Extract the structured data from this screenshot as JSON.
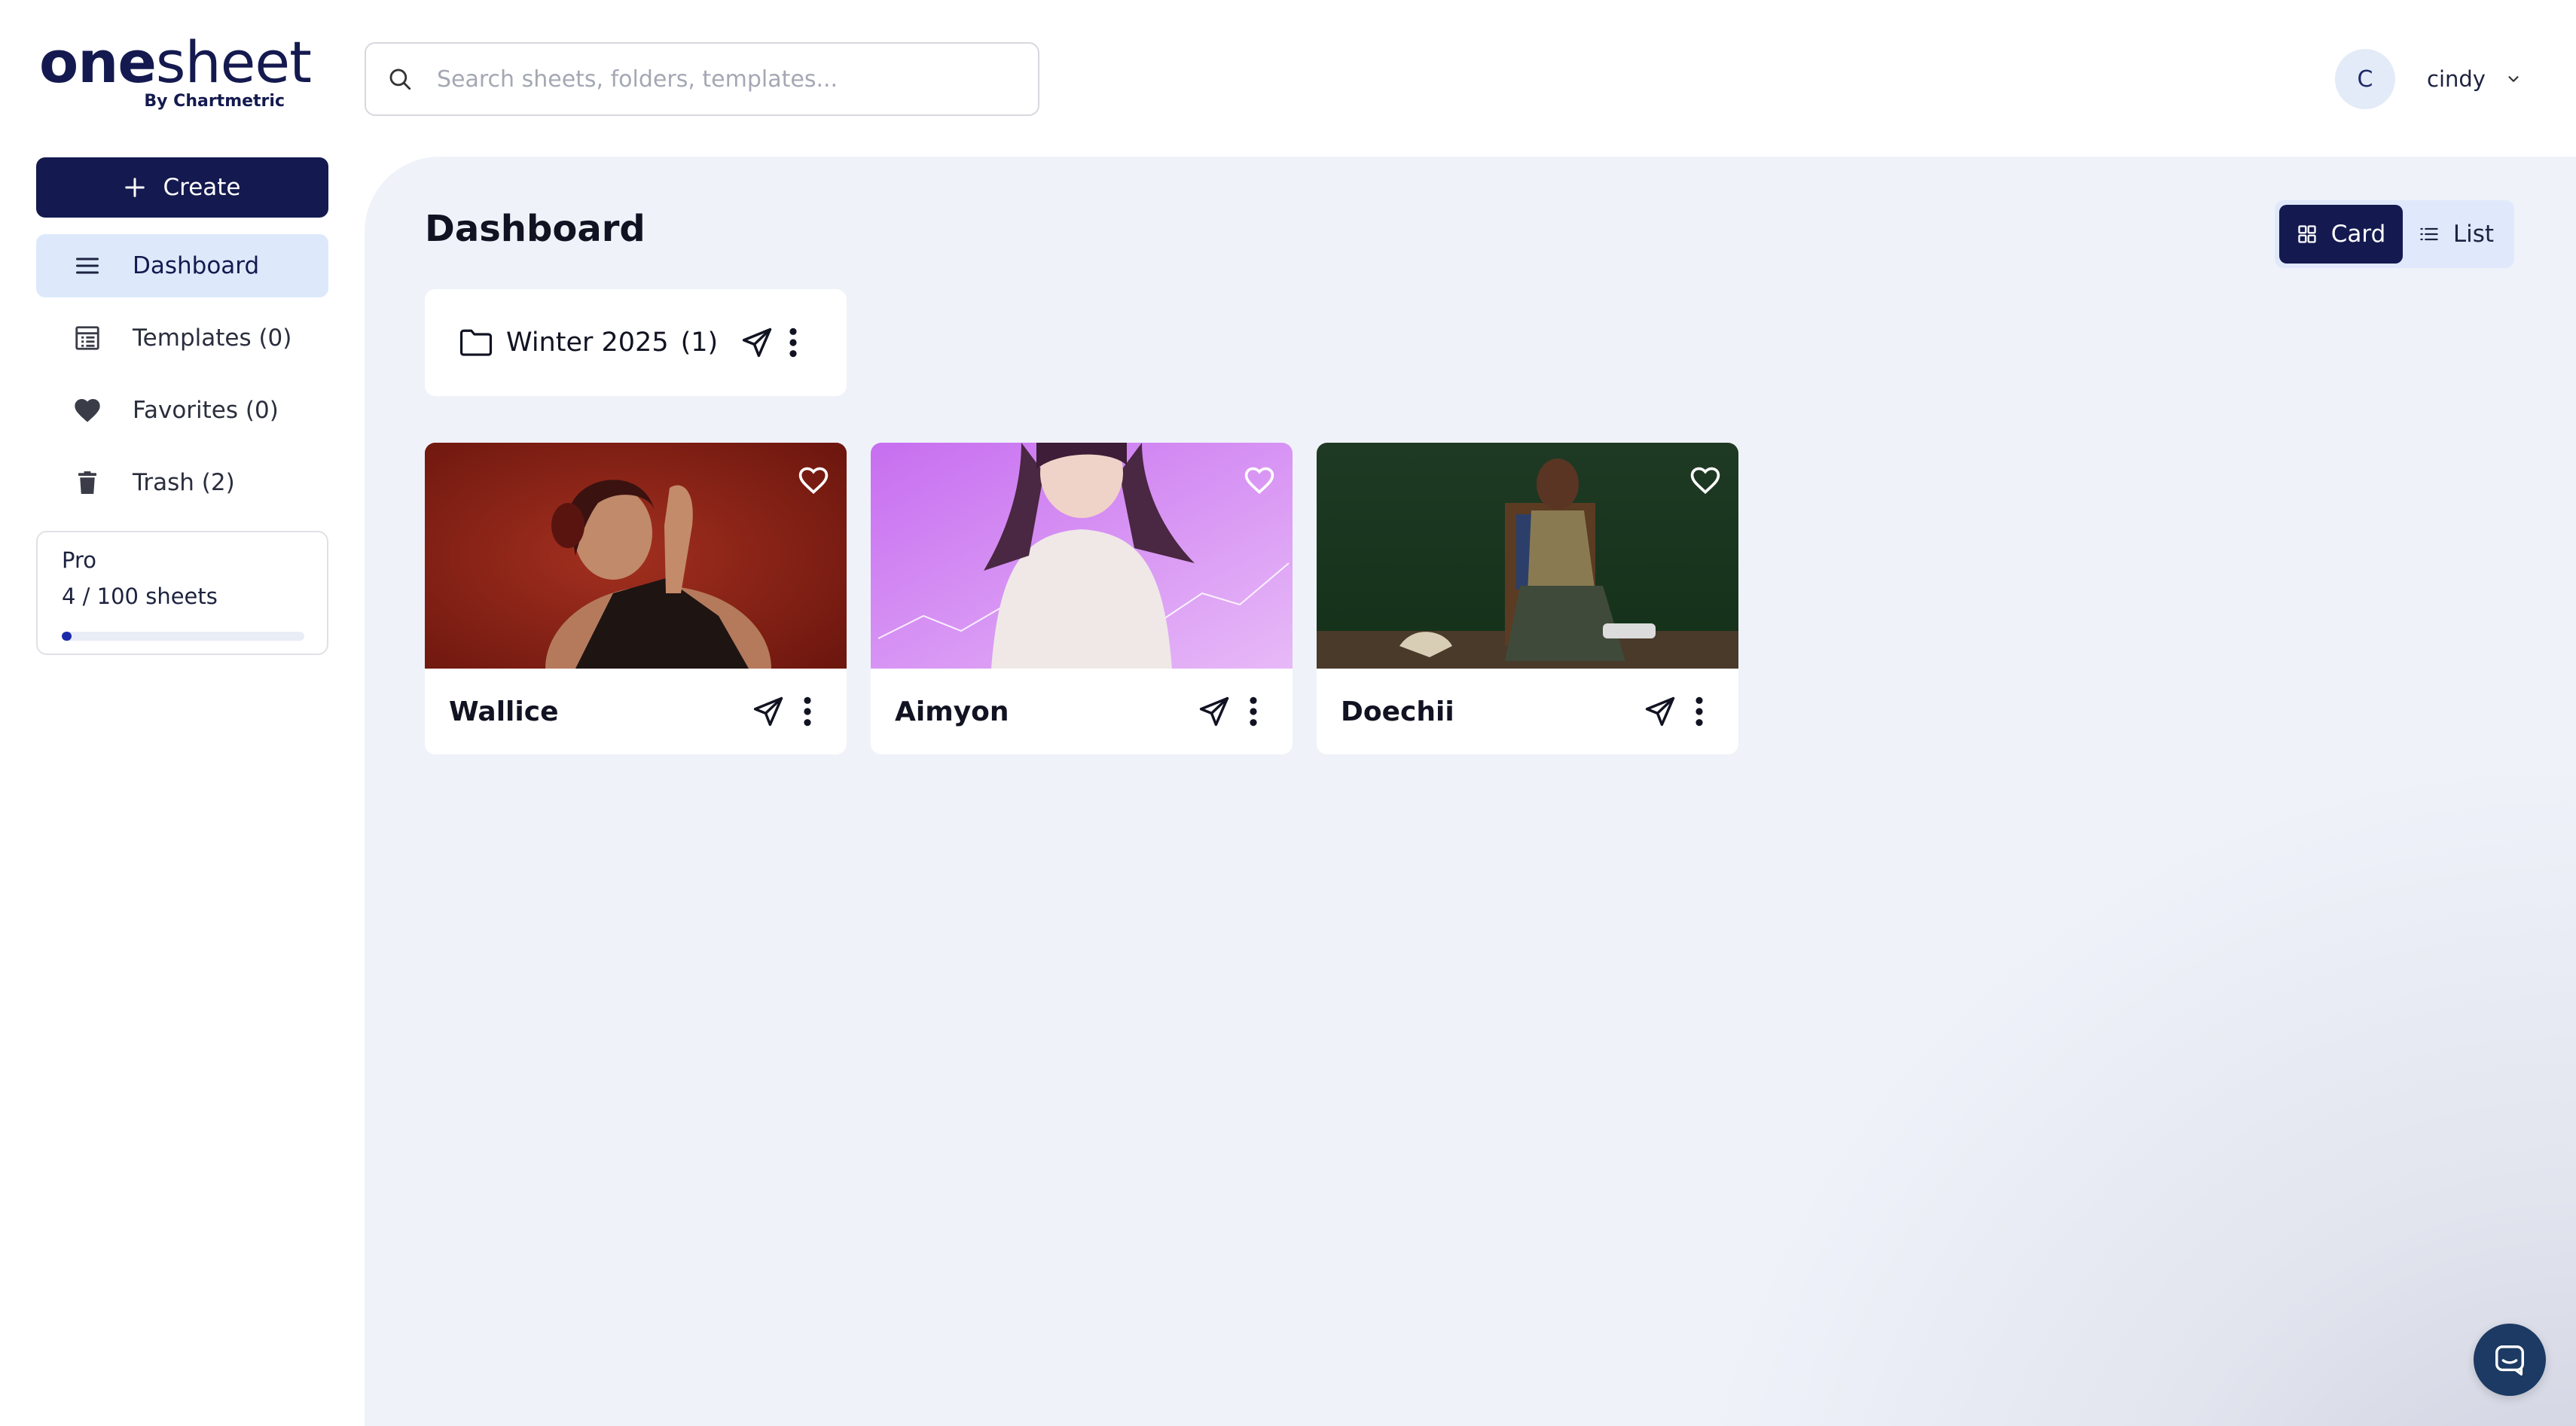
{
  "logo": {
    "word_bold": "one",
    "word_light": "sheet",
    "byline": "By Chartmetric"
  },
  "search": {
    "placeholder": "Search sheets, folders, templates..."
  },
  "user": {
    "initial": "C",
    "name": "cindy"
  },
  "sidebar": {
    "create_label": "Create",
    "items": [
      {
        "label": "Dashboard",
        "icon": "menu-icon",
        "active": true
      },
      {
        "label": "Templates (0)",
        "icon": "template-icon",
        "active": false
      },
      {
        "label": "Favorites (0)",
        "icon": "heart-icon",
        "active": false
      },
      {
        "label": "Trash (2)",
        "icon": "trash-icon",
        "active": false
      }
    ],
    "plan": {
      "name": "Pro",
      "usage": "4 / 100 sheets",
      "used": 4,
      "total": 100
    }
  },
  "main": {
    "title": "Dashboard",
    "view_toggle": {
      "card_label": "Card",
      "list_label": "List",
      "selected": "Card"
    },
    "folders": [
      {
        "name": "Winter 2025",
        "count": "(1)"
      }
    ],
    "cards": [
      {
        "name": "Wallice",
        "favorite": false
      },
      {
        "name": "Aimyon",
        "favorite": false
      },
      {
        "name": "Doechii",
        "favorite": false
      }
    ]
  },
  "colors": {
    "brand_navy": "#141a4f",
    "active_nav_bg": "#dde9fb",
    "main_bg": "#eff2f9",
    "progress_fill": "#1b2ba8",
    "chat_bubble": "#1c3a63"
  }
}
